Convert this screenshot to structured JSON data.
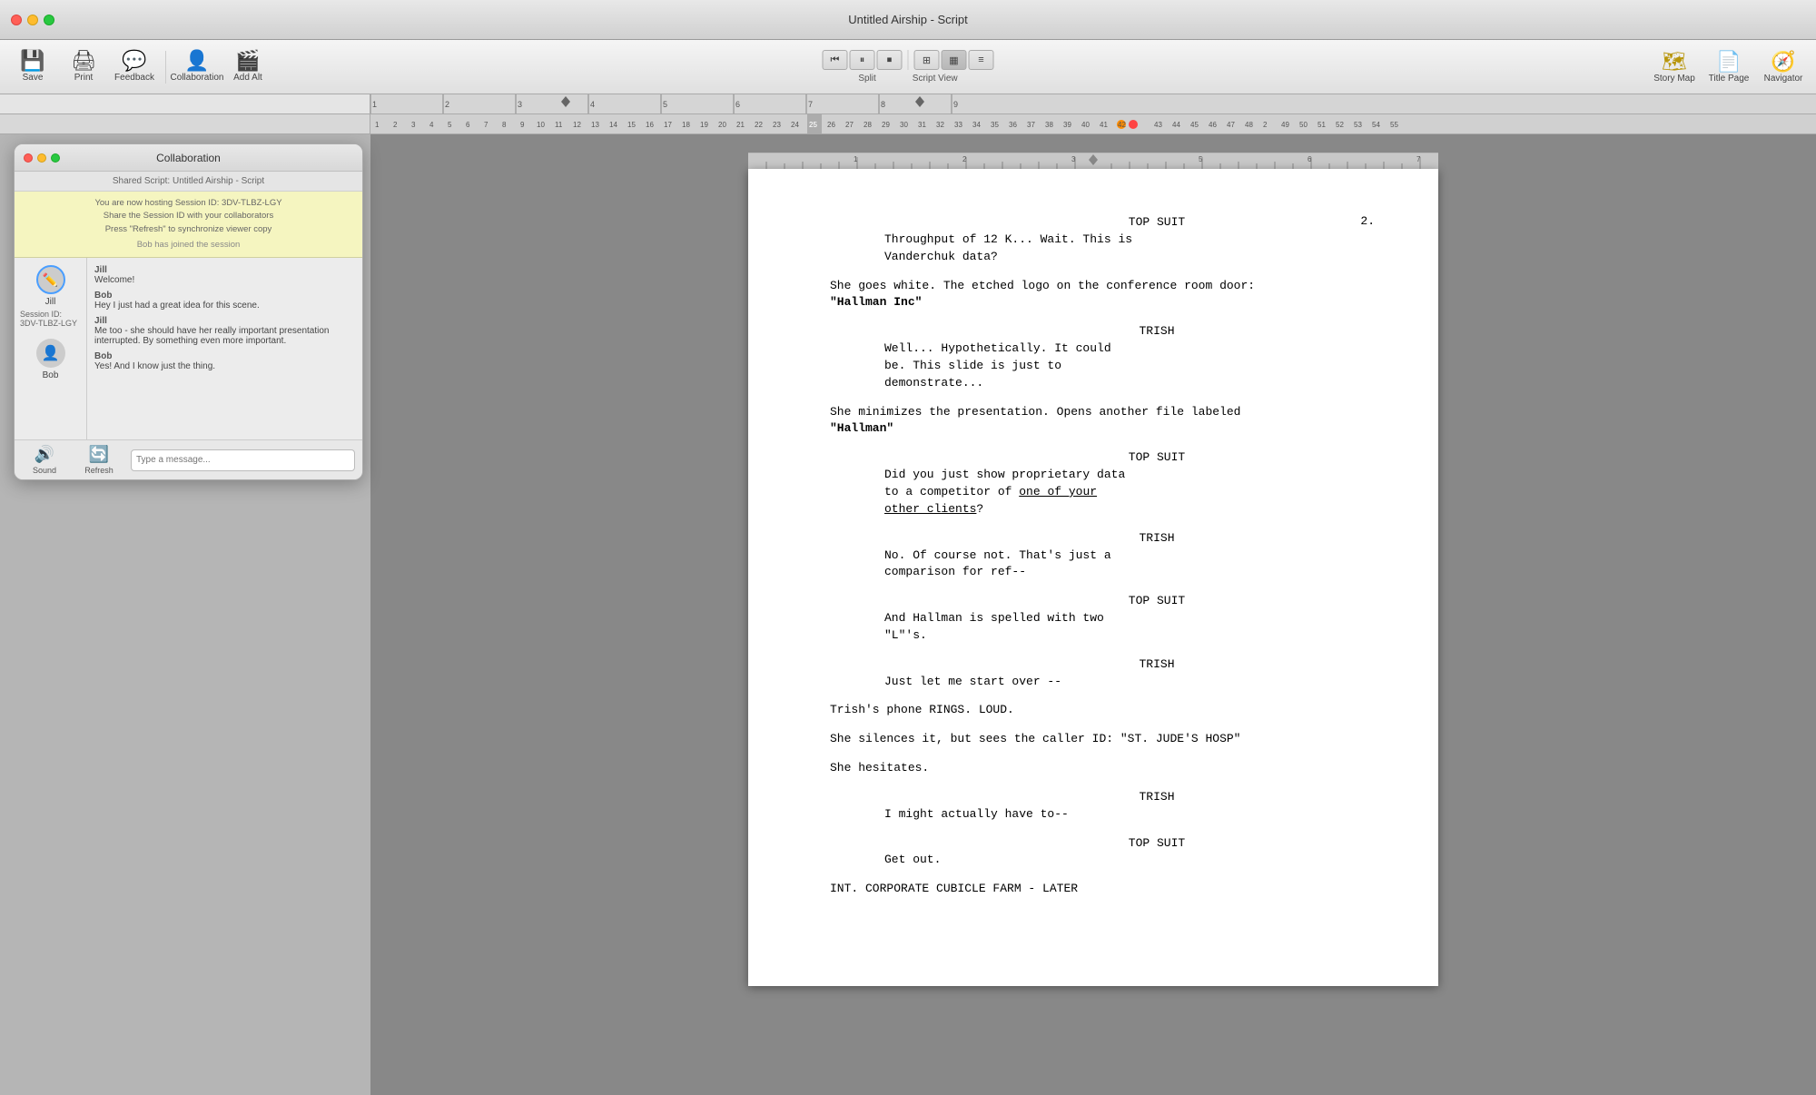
{
  "window": {
    "title": "Untitled Airship - Script"
  },
  "toolbar": {
    "save_label": "Save",
    "print_label": "Print",
    "feedback_label": "Feedback",
    "collaboration_label": "Collaboration",
    "add_alt_label": "Add Alt",
    "split_label": "Split",
    "script_view_label": "Script View",
    "story_map_label": "Story Map",
    "title_page_label": "Title Page",
    "navigator_label": "Navigator"
  },
  "collaboration_panel": {
    "title": "Collaboration",
    "shared_script_label": "Shared Script: Untitled Airship - Script",
    "hosting_line1": "You are now hosting Session ID: 3DV-TLBZ-LGY",
    "hosting_line2": "Share the Session ID with your collaborators",
    "hosting_line3": "Press \"Refresh\" to synchronize viewer copy",
    "bob_joined": "Bob has joined the session",
    "session_id_label": "Session ID:",
    "session_id_value": "3DV-TLBZ-LGY",
    "users": [
      {
        "name": "Jill",
        "active": true
      },
      {
        "name": "Bob",
        "active": false
      }
    ],
    "messages": [
      {
        "sender": "Jill",
        "text": "Welcome!"
      },
      {
        "sender": "Bob",
        "text": "Hey I just had a great idea for this scene."
      },
      {
        "sender": "Jill",
        "text": "Me too - she should have her really important presentation interrupted. By something even more important."
      },
      {
        "sender": "Bob",
        "text": "Yes! And I know just the thing."
      }
    ],
    "sound_label": "Sound",
    "refresh_label": "Refresh"
  },
  "script": {
    "title": "Untitled Airship - Script",
    "page_number": "2.",
    "content": [
      {
        "type": "character",
        "text": "TOP SUIT"
      },
      {
        "type": "dialogue",
        "text": "Throughput of 12 K... Wait. This is\nVanderchuk data?"
      },
      {
        "type": "spacer"
      },
      {
        "type": "action",
        "text": "She goes white. The etched logo on the conference room door:"
      },
      {
        "type": "action_bold",
        "text": "\"Hallman Inc\""
      },
      {
        "type": "spacer"
      },
      {
        "type": "character",
        "text": "TRISH"
      },
      {
        "type": "dialogue",
        "text": "Well... Hypothetically. It could\nbe. This slide is just to\ndemonstrate..."
      },
      {
        "type": "spacer"
      },
      {
        "type": "action",
        "text": "She minimizes the presentation. Opens another file labeled"
      },
      {
        "type": "action_bold",
        "text": "\"Hallman\""
      },
      {
        "type": "spacer"
      },
      {
        "type": "character",
        "text": "TOP SUIT"
      },
      {
        "type": "dialogue",
        "text": "Did you just show proprietary data\nto a competitor of one of your\nother clients?"
      },
      {
        "type": "spacer"
      },
      {
        "type": "character",
        "text": "TRISH"
      },
      {
        "type": "dialogue",
        "text": "No. Of course not. That’s just a\ncomparison for ref--"
      },
      {
        "type": "spacer"
      },
      {
        "type": "character",
        "text": "TOP SUIT"
      },
      {
        "type": "dialogue",
        "text": "And Hallman is spelled with two\n“L”’s."
      },
      {
        "type": "spacer"
      },
      {
        "type": "character",
        "text": "TRISH"
      },
      {
        "type": "dialogue",
        "text": "Just let me start over --"
      },
      {
        "type": "spacer"
      },
      {
        "type": "action",
        "text": "Trish’s phone RINGS. LOUD."
      },
      {
        "type": "spacer"
      },
      {
        "type": "action",
        "text": "She silences it, but sees the caller ID: “ST. JUDE’S HOSP”"
      },
      {
        "type": "spacer"
      },
      {
        "type": "action",
        "text": "She hesitates."
      },
      {
        "type": "spacer"
      },
      {
        "type": "character",
        "text": "TRISH"
      },
      {
        "type": "dialogue",
        "text": "I might actually have to--"
      },
      {
        "type": "spacer"
      },
      {
        "type": "character",
        "text": "TOP SUIT"
      },
      {
        "type": "dialogue",
        "text": "Get out."
      },
      {
        "type": "spacer"
      },
      {
        "type": "scene_heading",
        "text": "INT. CORPORATE CUBICLE FARM - LATER"
      }
    ]
  }
}
